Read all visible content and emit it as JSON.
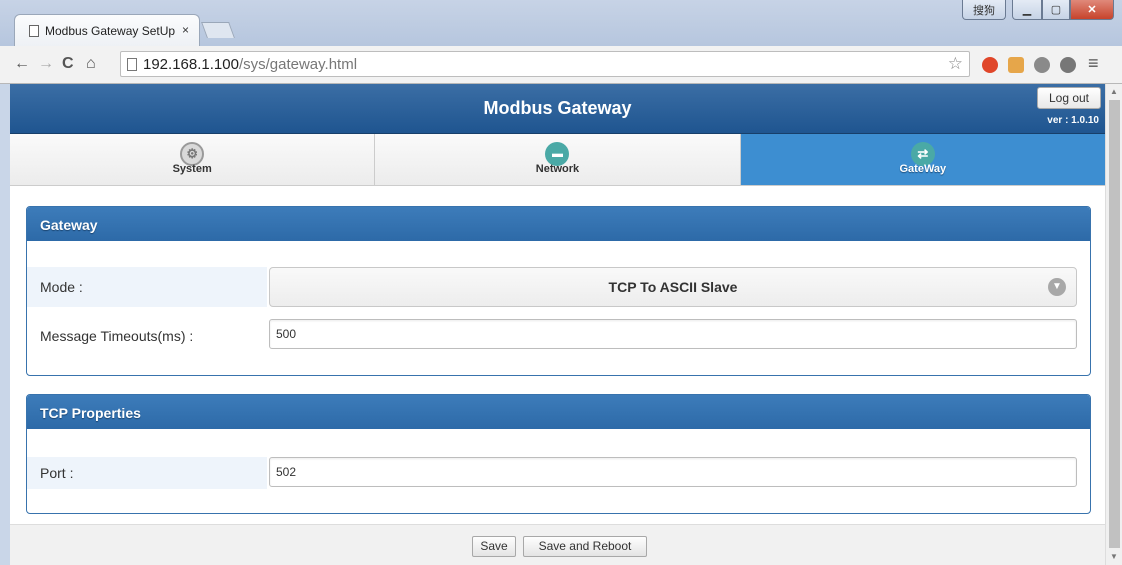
{
  "browser": {
    "tab_title": "Modbus Gateway SetUp",
    "tab_close": "×",
    "url_host": "192.168.1.100",
    "url_path": "/sys/gateway.html",
    "window_lang": "搜狗",
    "icons": [
      "back-icon",
      "forward-icon",
      "reload-icon",
      "home-icon",
      "page-icon",
      "star-icon",
      "menu-icon"
    ]
  },
  "header": {
    "title": "Modbus Gateway",
    "logout_label": "Log out",
    "version": "ver : 1.0.10"
  },
  "nav": {
    "tabs": [
      {
        "label": "System",
        "icon": "gear-icon",
        "active": false
      },
      {
        "label": "Network",
        "icon": "network-icon",
        "active": false
      },
      {
        "label": "GateWay",
        "icon": "exchange-arrows-icon",
        "active": true
      }
    ]
  },
  "gateway_panel": {
    "title": "Gateway",
    "mode_label": "Mode :",
    "mode_value": "TCP To ASCII Slave",
    "timeout_label": "Message Timeouts(ms) :",
    "timeout_value": "500"
  },
  "tcp_panel": {
    "title": "TCP Properties",
    "port_label": "Port :",
    "port_value": "502"
  },
  "footer": {
    "save_label": "Save",
    "save_reboot_label": "Save and Reboot"
  },
  "colors": {
    "header_blue": "#1f5590",
    "active_tab": "#3d8ed1",
    "panel_head": "#2d6aa8"
  }
}
